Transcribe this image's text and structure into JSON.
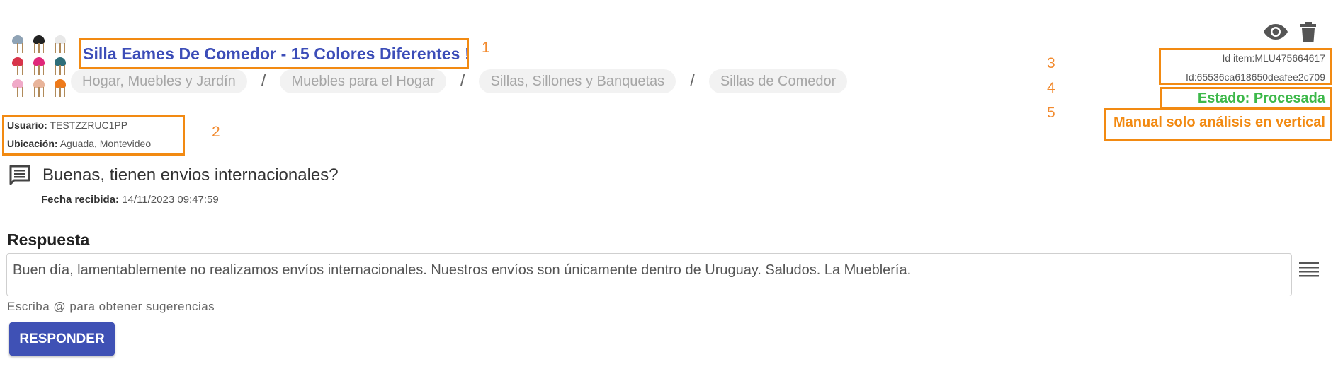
{
  "product": {
    "title": "Silla Eames De Comedor - 15 Colores Diferentes !",
    "thumbnail_colors": [
      "#8fa3b5",
      "#222222",
      "#e8e8e8",
      "#d8344a",
      "#e0287a",
      "#2e6e7a",
      "#f0aac8",
      "#e8b49a",
      "#ee7a1a"
    ]
  },
  "breadcrumb": [
    "Hogar, Muebles y Jardín",
    "Muebles para el Hogar",
    "Sillas, Sillones y Banquetas",
    "Sillas de Comedor"
  ],
  "breadcrumb_separator": "/",
  "user": {
    "usuario_label": "Usuario:",
    "usuario_value": "TESTZZRUC1PP",
    "ubicacion_label": "Ubicación:",
    "ubicacion_value": "Aguada, Montevideo"
  },
  "ids": {
    "item": "Id item:MLU475664617",
    "id": "Id:65536ca618650deafee2c709"
  },
  "status": {
    "estado": "Estado: Procesada",
    "manual": "Manual solo análisis en vertical"
  },
  "annotations": [
    "1",
    "2",
    "3",
    "4",
    "5"
  ],
  "question": {
    "text": "Buenas, tienen envios internacionales?",
    "fecha_label": "Fecha recibida:",
    "fecha_value": "14/11/2023 09:47:59"
  },
  "response": {
    "label": "Respuesta",
    "text": "Buen día, lamentablemente no realizamos envíos internacionales. Nuestros envíos son únicamente dentro de Uruguay. Saludos. La Mueblería.",
    "hint": "Escriba @ para obtener sugerencias",
    "button_label": "RESPONDER"
  },
  "icons": [
    "chair-thumbnail-image",
    "eye-icon",
    "trash-icon",
    "chat-icon",
    "menu-lines-icon"
  ],
  "colors": {
    "highlight": "#f28a12",
    "title": "#3c4db8",
    "estado": "#3db84a",
    "button": "#3f51b5"
  }
}
